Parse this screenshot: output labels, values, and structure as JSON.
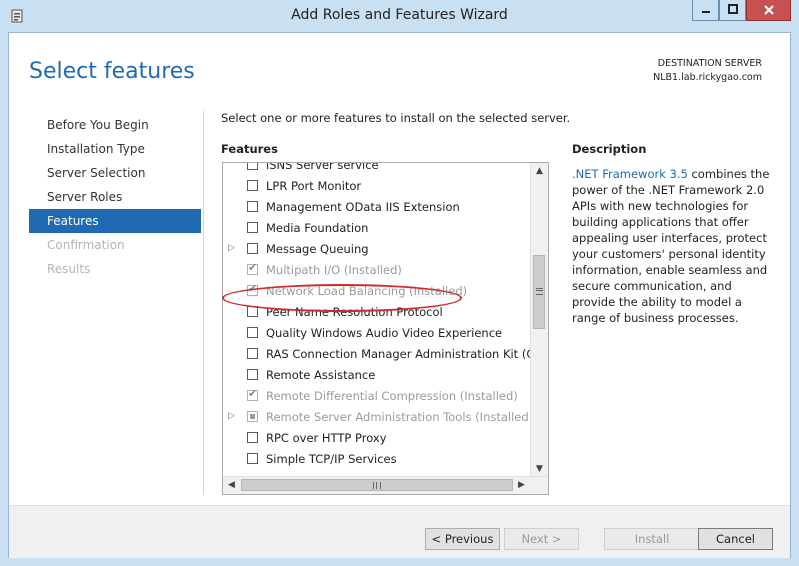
{
  "window": {
    "title": "Add Roles and Features Wizard"
  },
  "page": {
    "title": "Select features"
  },
  "destination": {
    "label": "DESTINATION SERVER",
    "server": "NLB1.lab.rickygao.com"
  },
  "nav": {
    "items": [
      {
        "label": "Before You Begin",
        "state": "normal"
      },
      {
        "label": "Installation Type",
        "state": "normal"
      },
      {
        "label": "Server Selection",
        "state": "normal"
      },
      {
        "label": "Server Roles",
        "state": "normal"
      },
      {
        "label": "Features",
        "state": "active"
      },
      {
        "label": "Confirmation",
        "state": "disabled"
      },
      {
        "label": "Results",
        "state": "disabled"
      }
    ]
  },
  "instruction": "Select one or more features to install on the selected server.",
  "features": {
    "label": "Features",
    "items": [
      {
        "label": "iSNS Server service",
        "checked": false,
        "installed": false,
        "expandable": false
      },
      {
        "label": "LPR Port Monitor",
        "checked": false,
        "installed": false,
        "expandable": false
      },
      {
        "label": "Management OData IIS Extension",
        "checked": false,
        "installed": false,
        "expandable": false
      },
      {
        "label": "Media Foundation",
        "checked": false,
        "installed": false,
        "expandable": false
      },
      {
        "label": "Message Queuing",
        "checked": false,
        "installed": false,
        "expandable": true
      },
      {
        "label": "Multipath I/O (Installed)",
        "checked": true,
        "installed": true,
        "expandable": false
      },
      {
        "label": "Network Load Balancing (Installed)",
        "checked": true,
        "installed": true,
        "expandable": false
      },
      {
        "label": "Peer Name Resolution Protocol",
        "checked": false,
        "installed": false,
        "expandable": false
      },
      {
        "label": "Quality Windows Audio Video Experience",
        "checked": false,
        "installed": false,
        "expandable": false
      },
      {
        "label": "RAS Connection Manager Administration Kit (CMA",
        "checked": false,
        "installed": false,
        "expandable": false
      },
      {
        "label": "Remote Assistance",
        "checked": false,
        "installed": false,
        "expandable": false
      },
      {
        "label": "Remote Differential Compression (Installed)",
        "checked": true,
        "installed": true,
        "expandable": false
      },
      {
        "label": "Remote Server Administration Tools (Installed)",
        "checked": "partial",
        "installed": true,
        "expandable": true
      },
      {
        "label": "RPC over HTTP Proxy",
        "checked": false,
        "installed": false,
        "expandable": false
      },
      {
        "label": "Simple TCP/IP Services",
        "checked": false,
        "installed": false,
        "expandable": false
      }
    ]
  },
  "description": {
    "label": "Description",
    "link": ".NET Framework 3.5",
    "text": " combines the power of the .NET Framework 2.0 APIs with new technologies for building applications that offer appealing user interfaces, protect your customers' personal identity information, enable seamless and secure communication, and provide the ability to model a range of business processes."
  },
  "footer": {
    "previous": "< Previous",
    "next": "Next >",
    "install": "Install",
    "cancel": "Cancel"
  },
  "colors": {
    "accent": "#1f6ab3",
    "highlight_circle": "#d12a2a",
    "close_button": "#c75050"
  },
  "icons": {
    "app": "server-manager-icon",
    "min": "minimize-icon",
    "max": "maximize-icon",
    "close": "close-icon"
  }
}
